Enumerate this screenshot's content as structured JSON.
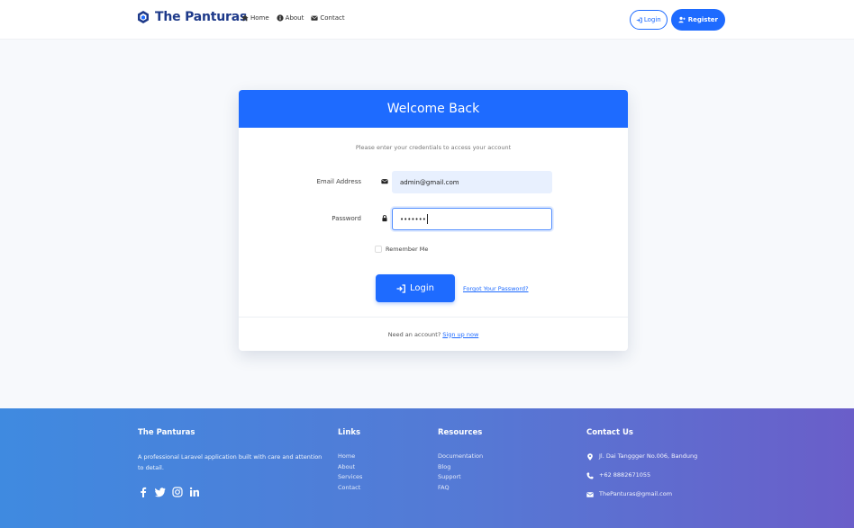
{
  "navbar": {
    "brand": "The Panturas",
    "links": [
      {
        "label": "Home"
      },
      {
        "label": "About"
      },
      {
        "label": "Contact"
      }
    ],
    "login_label": "Login",
    "register_label": "Register"
  },
  "card": {
    "title": "Welcome Back",
    "subtitle": "Please enter your credentials to access your account",
    "email_label": "Email Address",
    "email_value": "admin@gmail.com",
    "password_label": "Password",
    "password_value": "•••••••",
    "remember_label": "Remember Me",
    "login_button": "Login",
    "forgot_link": "Forgot Your Password?",
    "footer_text": "Need an account?",
    "signup_link": "Sign up now"
  },
  "footer": {
    "about": {
      "title": "The Panturas",
      "text": "A professional Laravel application built with care and attention to detail."
    },
    "links": {
      "title": "Links",
      "items": [
        "Home",
        "About",
        "Services",
        "Contact"
      ]
    },
    "resources": {
      "title": "Resources",
      "items": [
        "Documentation",
        "Blog",
        "Support",
        "FAQ"
      ]
    },
    "contact": {
      "title": "Contact Us",
      "address": "Jl. Dai Tanggger No.006, Bandung",
      "phone": "+62 8882671055",
      "email": "ThePanturas@gmail.com"
    }
  },
  "colors": {
    "primary": "#1e6bff",
    "brand": "#1e3a8a",
    "footer_start": "#3f8ae0",
    "footer_end": "#6a5ec9"
  }
}
